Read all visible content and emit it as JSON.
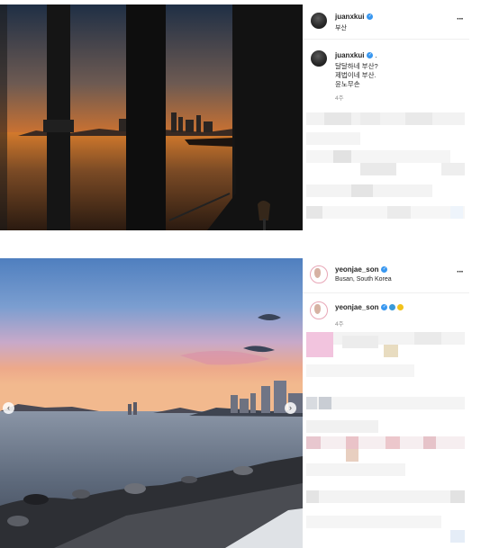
{
  "posts": [
    {
      "username": "juanxkui",
      "location": "부산",
      "more_label": "···",
      "caption_username": "juanxkui",
      "caption_suffix": ".",
      "caption_lines": [
        "달달하네 부산?",
        "제법이네 부산.",
        "윤노무손"
      ],
      "time": "4주"
    },
    {
      "username": "yeonjae_son",
      "location": "Busan, South Korea",
      "more_label": "···",
      "caption_username": "yeonjae_son",
      "emoji_colors": [
        "#3a9ad9",
        "#f2c21b"
      ],
      "time": "4주",
      "carousel_prev": "‹",
      "carousel_next": "›"
    }
  ],
  "colors": {
    "verified": "#3897f0",
    "muted_text": "#8e8e8e",
    "divider": "#efefef"
  }
}
